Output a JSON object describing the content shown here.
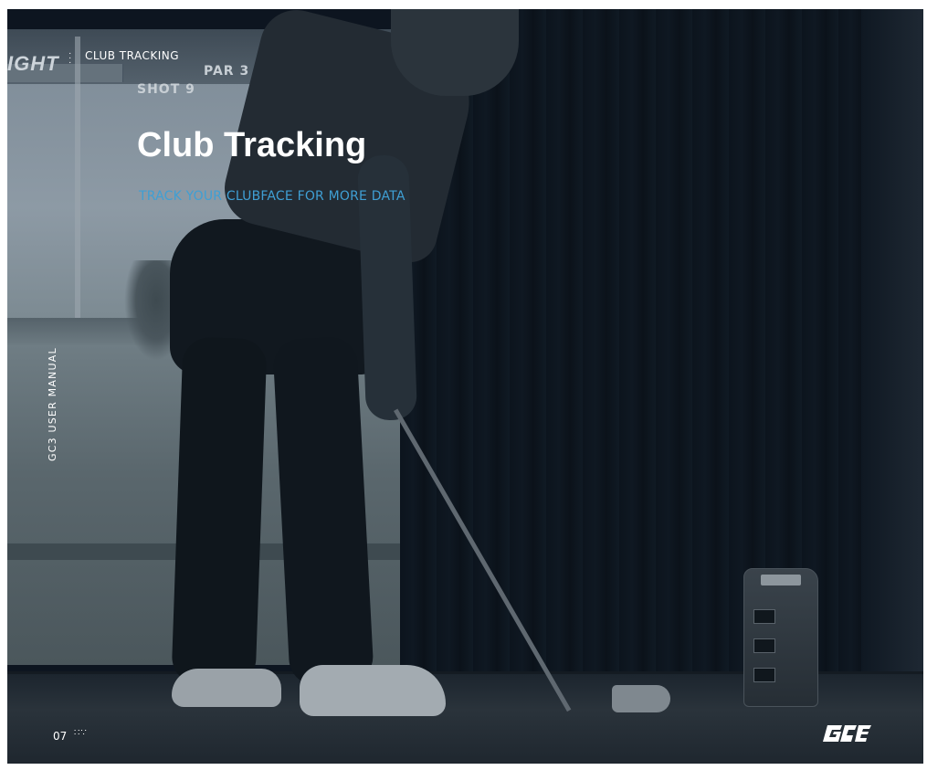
{
  "header": {
    "section_label": "CLUB TRACKING",
    "menu_icon": "vertical-dots-icon"
  },
  "hero": {
    "title": "Club Tracking",
    "subtitle": "TRACK YOUR CLUBFACE FOR MORE DATA"
  },
  "sidebar": {
    "manual_label": "GC3 USER MANUAL"
  },
  "simulator_screen": {
    "par_label": "PAR 3",
    "shot_label": "SHOT 9"
  },
  "footer": {
    "page_number": "07",
    "page_marker_icon": "dotted-grid-icon",
    "brand_logo": "gc3-logo"
  },
  "colors": {
    "accent": "#3f9fd4",
    "background": "#0d1520",
    "text": "#ffffff"
  }
}
